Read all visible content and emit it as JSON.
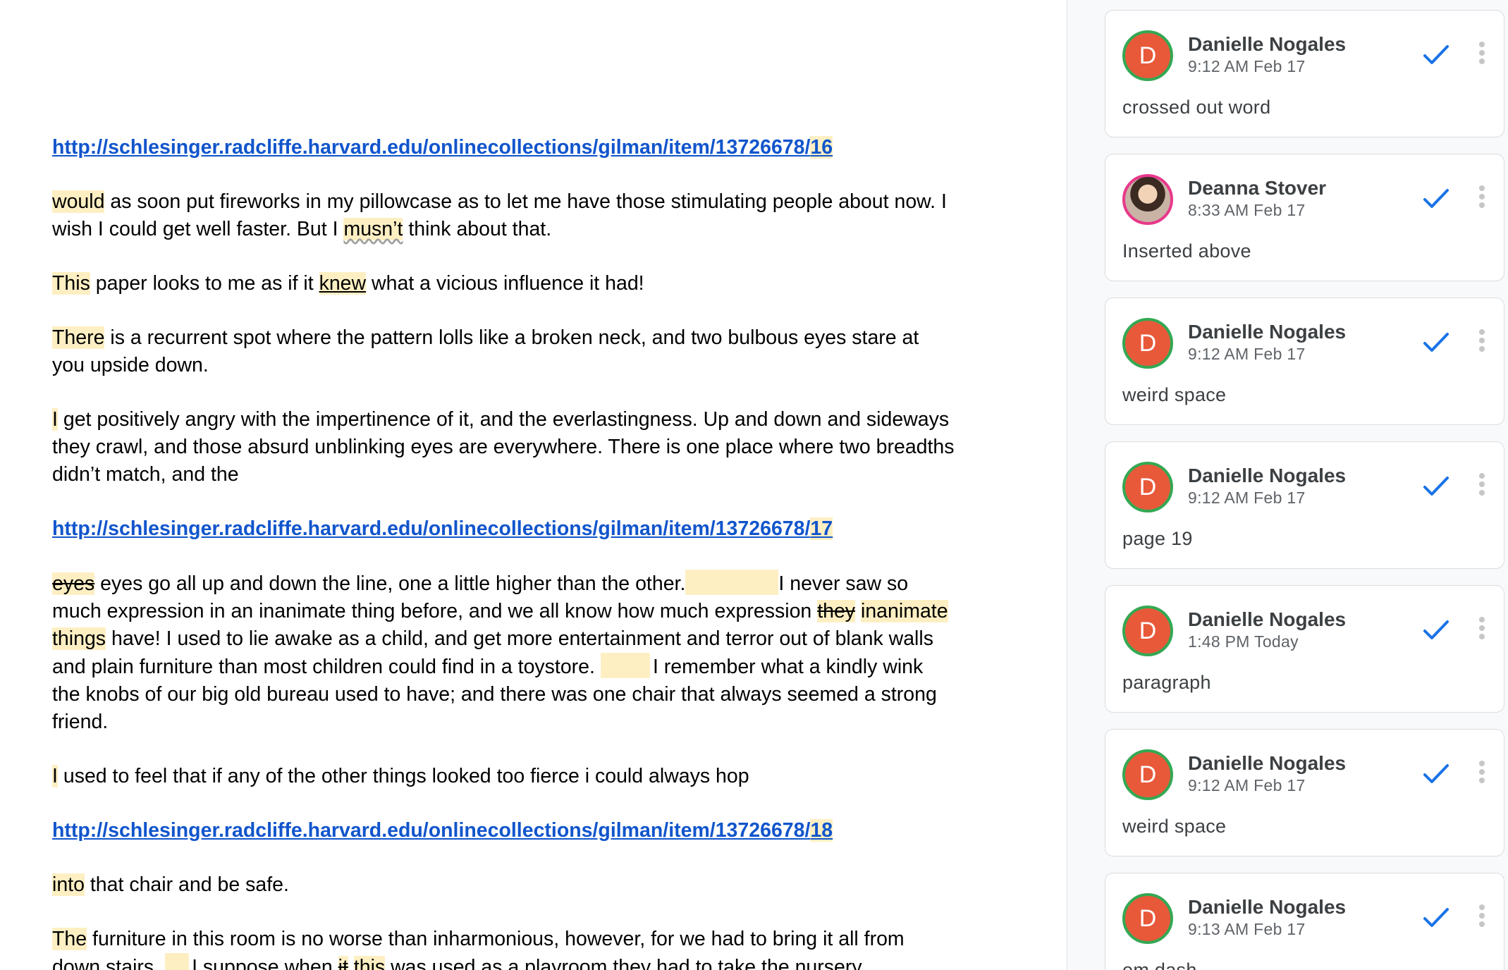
{
  "document": {
    "paragraphs": [
      {
        "type": "link",
        "prefix": "http://schlesinger.radcliffe.harvard.edu/onlinecollections/gilman/item/13726678/",
        "page": "16"
      },
      {
        "type": "text",
        "parts": [
          "would",
          " as soon put fireworks in my pillowcase as to let me have those stimulating people about now. I wish I could get well faster. But I ",
          "musn’t",
          " think about that."
        ]
      },
      {
        "type": "text",
        "parts": [
          " This",
          " paper looks to me as if it ",
          "knew",
          " what a vicious influence it had!"
        ]
      },
      {
        "type": "text",
        "parts": [
          "There",
          " is a recurrent spot where the pattern lolls like a broken neck, and two bulbous eyes stare at you upside down."
        ]
      },
      {
        "type": "text",
        "parts": [
          "I",
          " get positively angry with the impertinence of it, and the everlastingness. Up and down and sideways they crawl, and those absurd unblinking eyes are everywhere. There is one place where two breadths didn’t match, and the"
        ]
      },
      {
        "type": "link",
        "prefix": "http://schlesinger.radcliffe.harvard.edu/onlinecollections/gilman/item/13726678/",
        "page": "17"
      },
      {
        "type": "text",
        "parts": [
          "eyes",
          " eyes go all up and down the line, one a little higher than the other.",
          "I never saw so much expression in an inanimate thing before, and we all know how much expression ",
          "they",
          "inanimate things",
          " have! I used to lie awake as a child, and get more entertainment and terror out of blank walls and plain furniture than most children could find in a toystore.",
          "I remember what a kindly wink the knobs of our big old bureau used to have; and there was one chair that always seemed a strong friend."
        ]
      },
      {
        "type": "text",
        "parts": [
          "I",
          " used to feel that if any of the other things looked too fierce i could always hop"
        ]
      },
      {
        "type": "link",
        "prefix": "http://schlesinger.radcliffe.harvard.edu/onlinecollections/gilman/item/13726678/",
        "page": "18"
      },
      {
        "type": "text",
        "parts": [
          "into",
          " that chair and be safe."
        ]
      },
      {
        "type": "text",
        "parts": [
          "The",
          " furniture in this room is no worse than inharmonious, however, for we had to bring it all from down stairs.",
          "I suppose when ",
          "it",
          "this",
          " was used as a playroom they had to take the nursery"
        ]
      }
    ]
  },
  "comments": [
    {
      "author": "Danielle Nogales",
      "initial": "D",
      "time": "9:12 AM Feb 17",
      "text": "crossed out word"
    },
    {
      "author": "Deanna Stover",
      "initial": "",
      "time": "8:33 AM Feb 17",
      "text": "Inserted above"
    },
    {
      "author": "Danielle Nogales",
      "initial": "D",
      "time": "9:12 AM Feb 17",
      "text": "weird space"
    },
    {
      "author": "Danielle Nogales",
      "initial": "D",
      "time": "9:12 AM Feb 17",
      "text": "page 19"
    },
    {
      "author": "Danielle Nogales",
      "initial": "D",
      "time": "1:48 PM Today",
      "text": "paragraph"
    },
    {
      "author": "Danielle Nogales",
      "initial": "D",
      "time": "9:12 AM Feb 17",
      "text": "weird space"
    },
    {
      "author": "Danielle Nogales",
      "initial": "D",
      "time": "9:13 AM Feb 17",
      "text": "em dash"
    }
  ],
  "colors": {
    "highlight": "#feefc3",
    "link": "#1155cc",
    "avatar_bg": "#e8593a",
    "avatar_ring": "#34a853",
    "resolve_check": "#1a73e8"
  },
  "icons": {
    "resolve": "checkmark-icon",
    "more": "more-vert-icon"
  }
}
